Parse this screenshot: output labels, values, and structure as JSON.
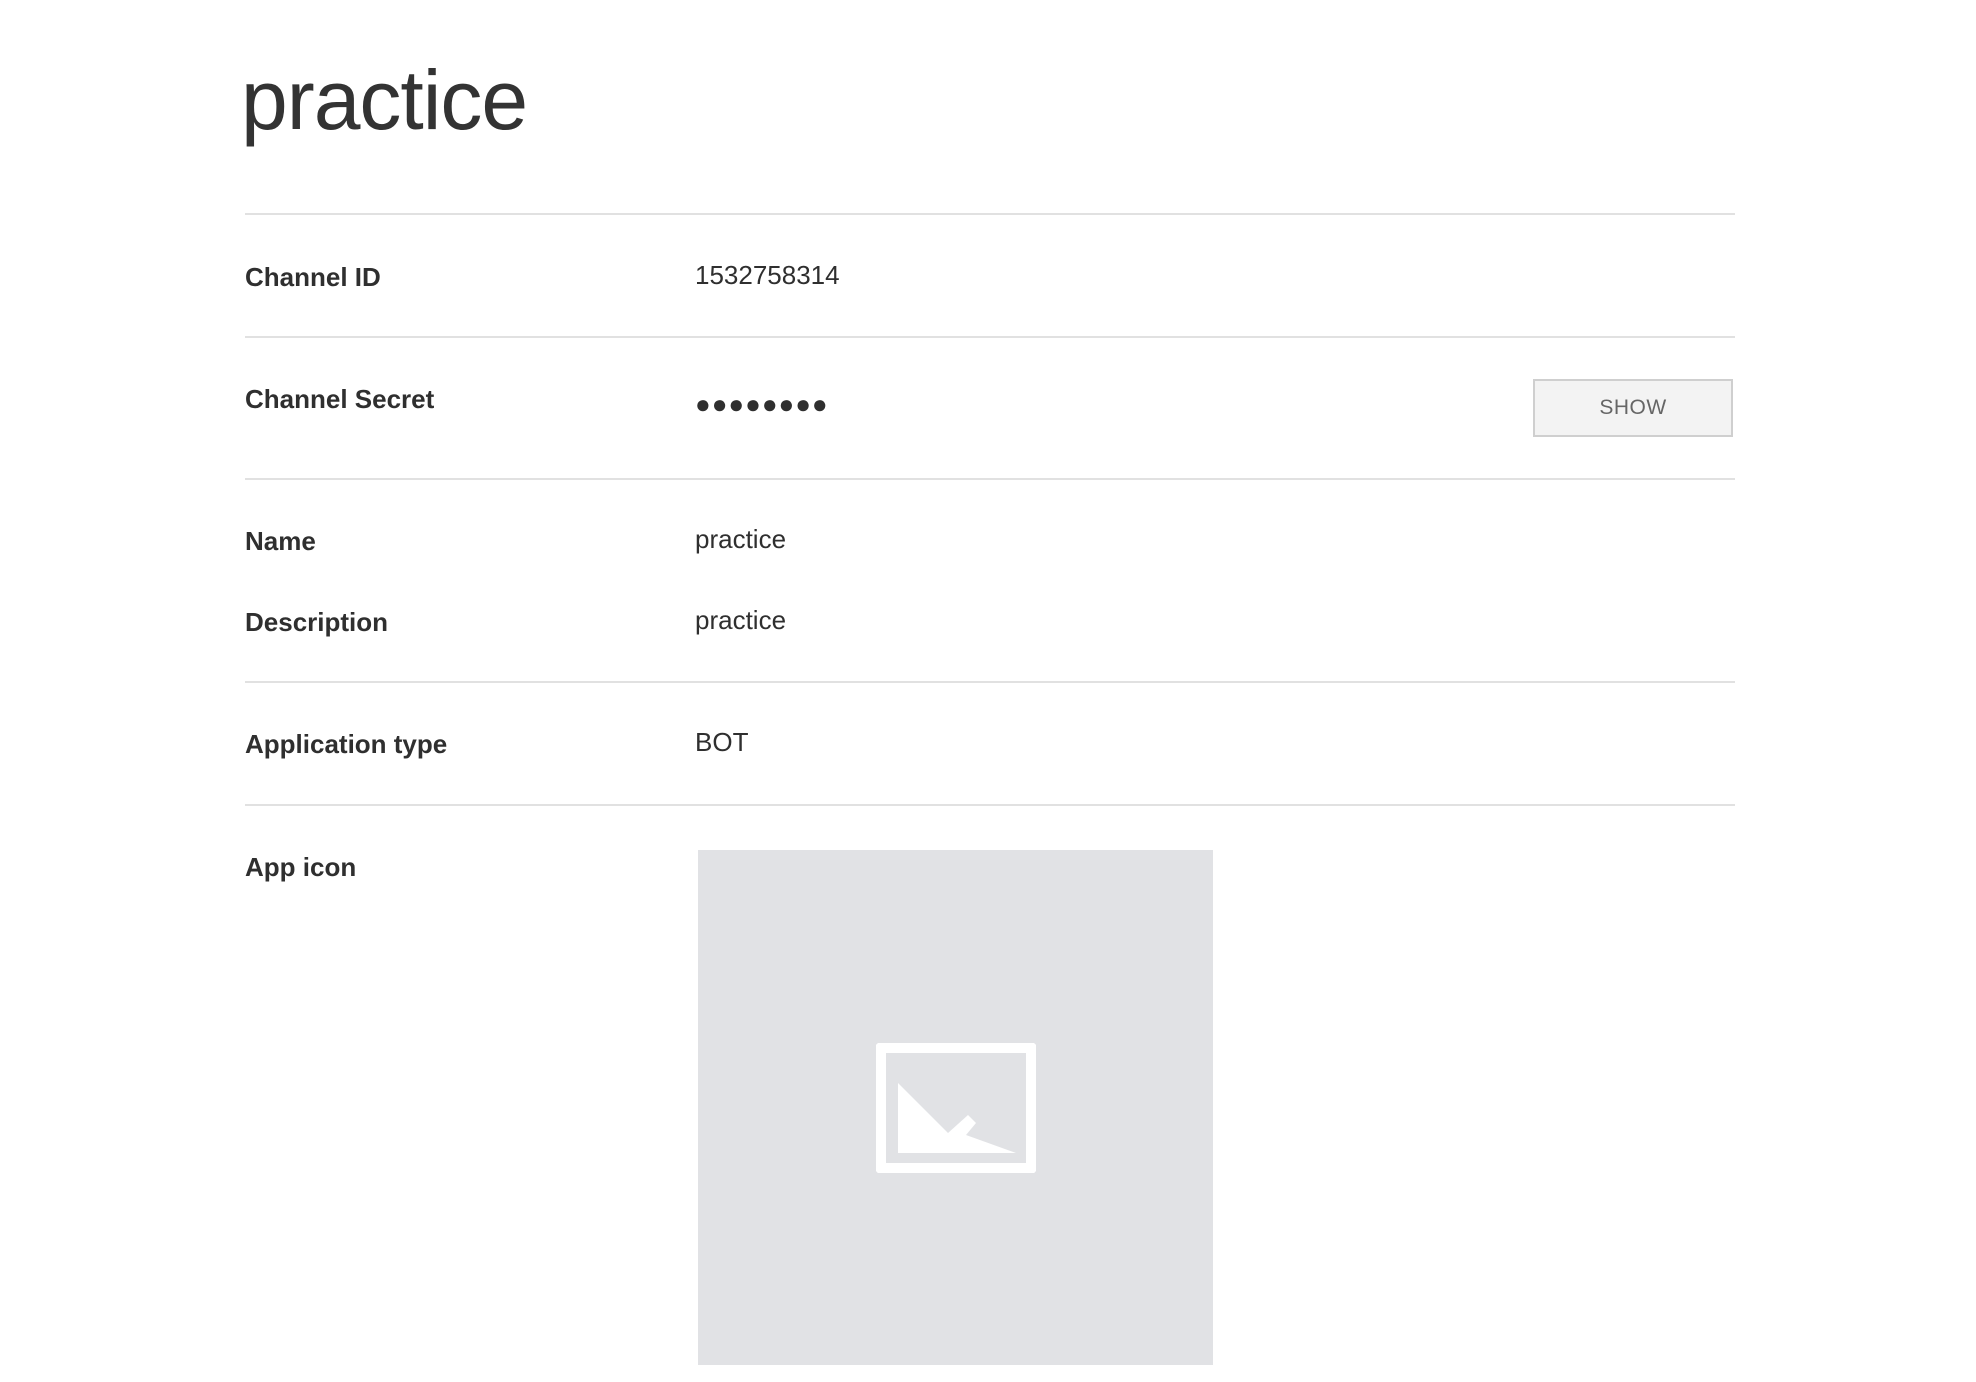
{
  "page": {
    "title": "practice"
  },
  "fields": {
    "channel_id": {
      "label": "Channel ID",
      "value": "1532758314"
    },
    "channel_secret": {
      "label": "Channel Secret",
      "masked_value": "●●●●●●●●",
      "show_button_label": "SHOW"
    },
    "name": {
      "label": "Name",
      "value": "practice"
    },
    "description": {
      "label": "Description",
      "value": "practice"
    },
    "application_type": {
      "label": "Application type",
      "value": "BOT"
    },
    "app_icon": {
      "label": "App icon",
      "icon": "image-placeholder-icon",
      "placeholder_bg": "#e1e2e5",
      "placeholder_fg": "#ffffff"
    }
  },
  "colors": {
    "text": "#2f2f2f",
    "divider": "#e1e1e1",
    "button_bg": "#f3f3f3",
    "button_border": "#cfcfcf",
    "button_text": "#666666"
  }
}
